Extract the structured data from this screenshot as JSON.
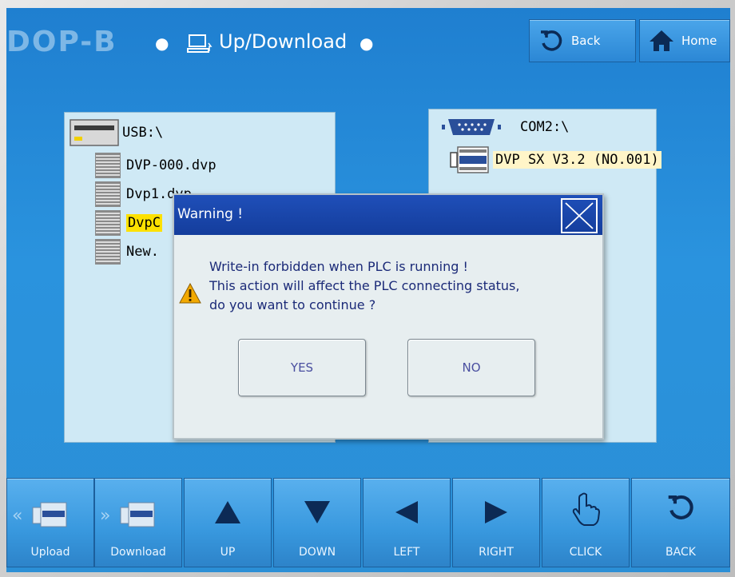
{
  "header": {
    "brand": "DOP-B",
    "title": "Up/Download",
    "back_label": "Back",
    "home_label": "Home"
  },
  "left_panel": {
    "drive_label": "USB:\\",
    "files": [
      "DVP-000.dvp",
      "Dvp1.dvp",
      "DvpC",
      "New."
    ]
  },
  "right_panel": {
    "port_label": "COM2:\\",
    "device": "DVP SX V3.2 (NO.001)"
  },
  "dialog": {
    "title": "Warning !",
    "message": [
      "Write-in forbidden when PLC is running !",
      "This action will affect the PLC connecting status,",
      "do you want to continue ?"
    ],
    "yes_label": "YES",
    "no_label": "NO"
  },
  "toolbar": [
    {
      "label": "Upload"
    },
    {
      "label": "Download"
    },
    {
      "label": "UP"
    },
    {
      "label": "DOWN"
    },
    {
      "label": "LEFT"
    },
    {
      "label": "RIGHT"
    },
    {
      "label": "CLICK"
    },
    {
      "label": "BACK"
    }
  ],
  "colors": {
    "screen_blue": "#2a93de",
    "dialog_title_blue": "#1f4fb9",
    "selection_yellow": "#fde100",
    "warning_amber": "#f2a900"
  },
  "icons": [
    "pc-icon",
    "back-icon",
    "home-icon",
    "usb-drive-icon",
    "serial-port-icon",
    "warning-icon",
    "close-icon",
    "hand-pointer-icon"
  ]
}
